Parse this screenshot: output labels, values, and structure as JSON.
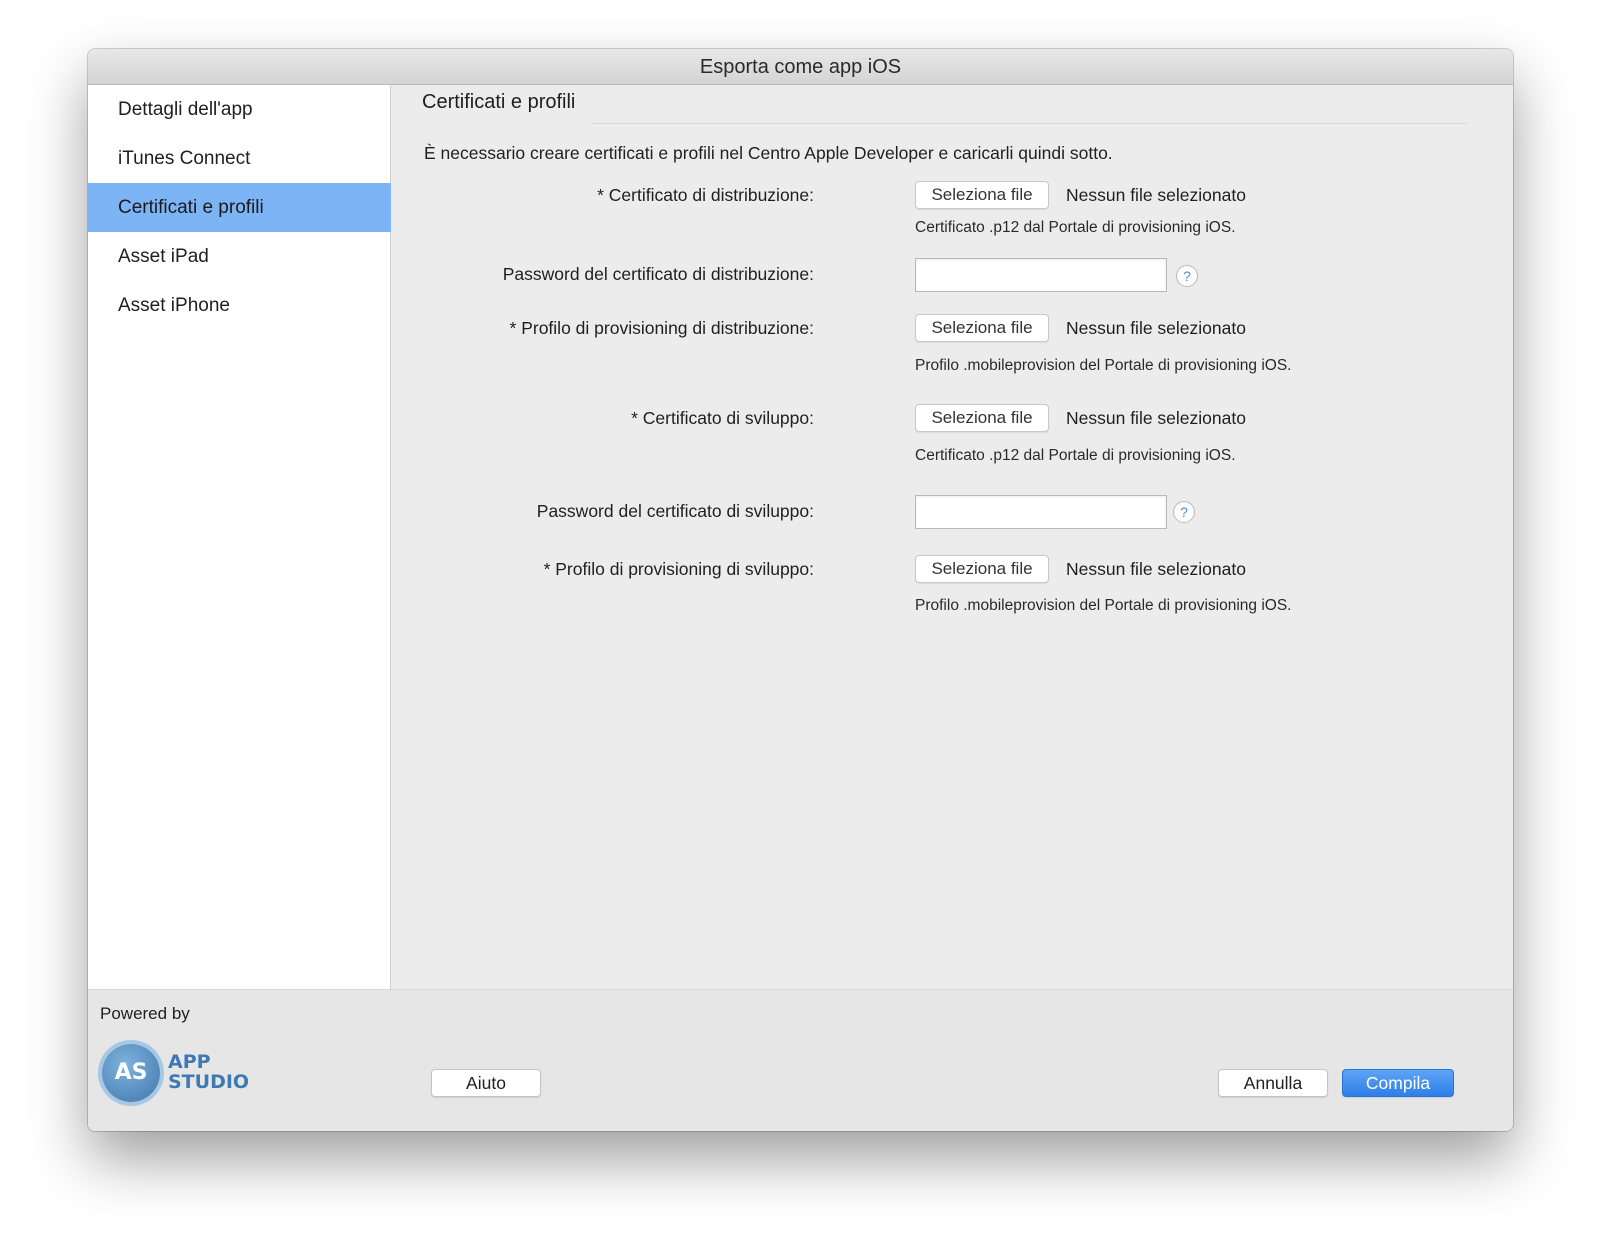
{
  "window": {
    "title": "Esporta come app iOS"
  },
  "sidebar": {
    "items": [
      {
        "label": "Dettagli dell'app",
        "selected": false
      },
      {
        "label": "iTunes Connect",
        "selected": false
      },
      {
        "label": "Certificati e profili",
        "selected": true
      },
      {
        "label": "Asset iPad",
        "selected": false
      },
      {
        "label": "Asset iPhone",
        "selected": false
      }
    ]
  },
  "main": {
    "section_title": "Certificati e profili",
    "intro": "È necessario creare certificati e profili nel Centro Apple Developer e caricarli quindi sotto.",
    "rows": [
      {
        "label": "* Certificato di distribuzione:",
        "button_label": "Seleziona file",
        "status": "Nessun file selezionato",
        "hint": "Certificato .p12 dal Portale di provisioning iOS."
      },
      {
        "label": "Password del certificato di distribuzione:",
        "value": "",
        "help_icon": "?"
      },
      {
        "label": "* Profilo di provisioning di distribuzione:",
        "button_label": "Seleziona file",
        "status": "Nessun file selezionato",
        "hint": "Profilo .mobileprovision del Portale di provisioning iOS."
      },
      {
        "label": "* Certificato di sviluppo:",
        "button_label": "Seleziona file",
        "status": "Nessun file selezionato",
        "hint": "Certificato .p12 dal Portale di provisioning iOS."
      },
      {
        "label": "Password del certificato di sviluppo:",
        "value": "",
        "help_icon": "?"
      },
      {
        "label": "* Profilo di provisioning di sviluppo:",
        "button_label": "Seleziona file",
        "status": "Nessun file selezionato",
        "hint": "Profilo .mobileprovision del Portale di provisioning iOS."
      }
    ]
  },
  "footer": {
    "powered_by": "Powered by",
    "logo": {
      "monogram": "AS",
      "line1": "APP",
      "line2": "STUDIO"
    },
    "help_label": "Aiuto",
    "cancel_label": "Annulla",
    "build_label": "Compila"
  },
  "colors": {
    "selected_item": "#7db4f5",
    "primary_button": "#2e7fe8",
    "logo_blue": "#3d79b3"
  }
}
